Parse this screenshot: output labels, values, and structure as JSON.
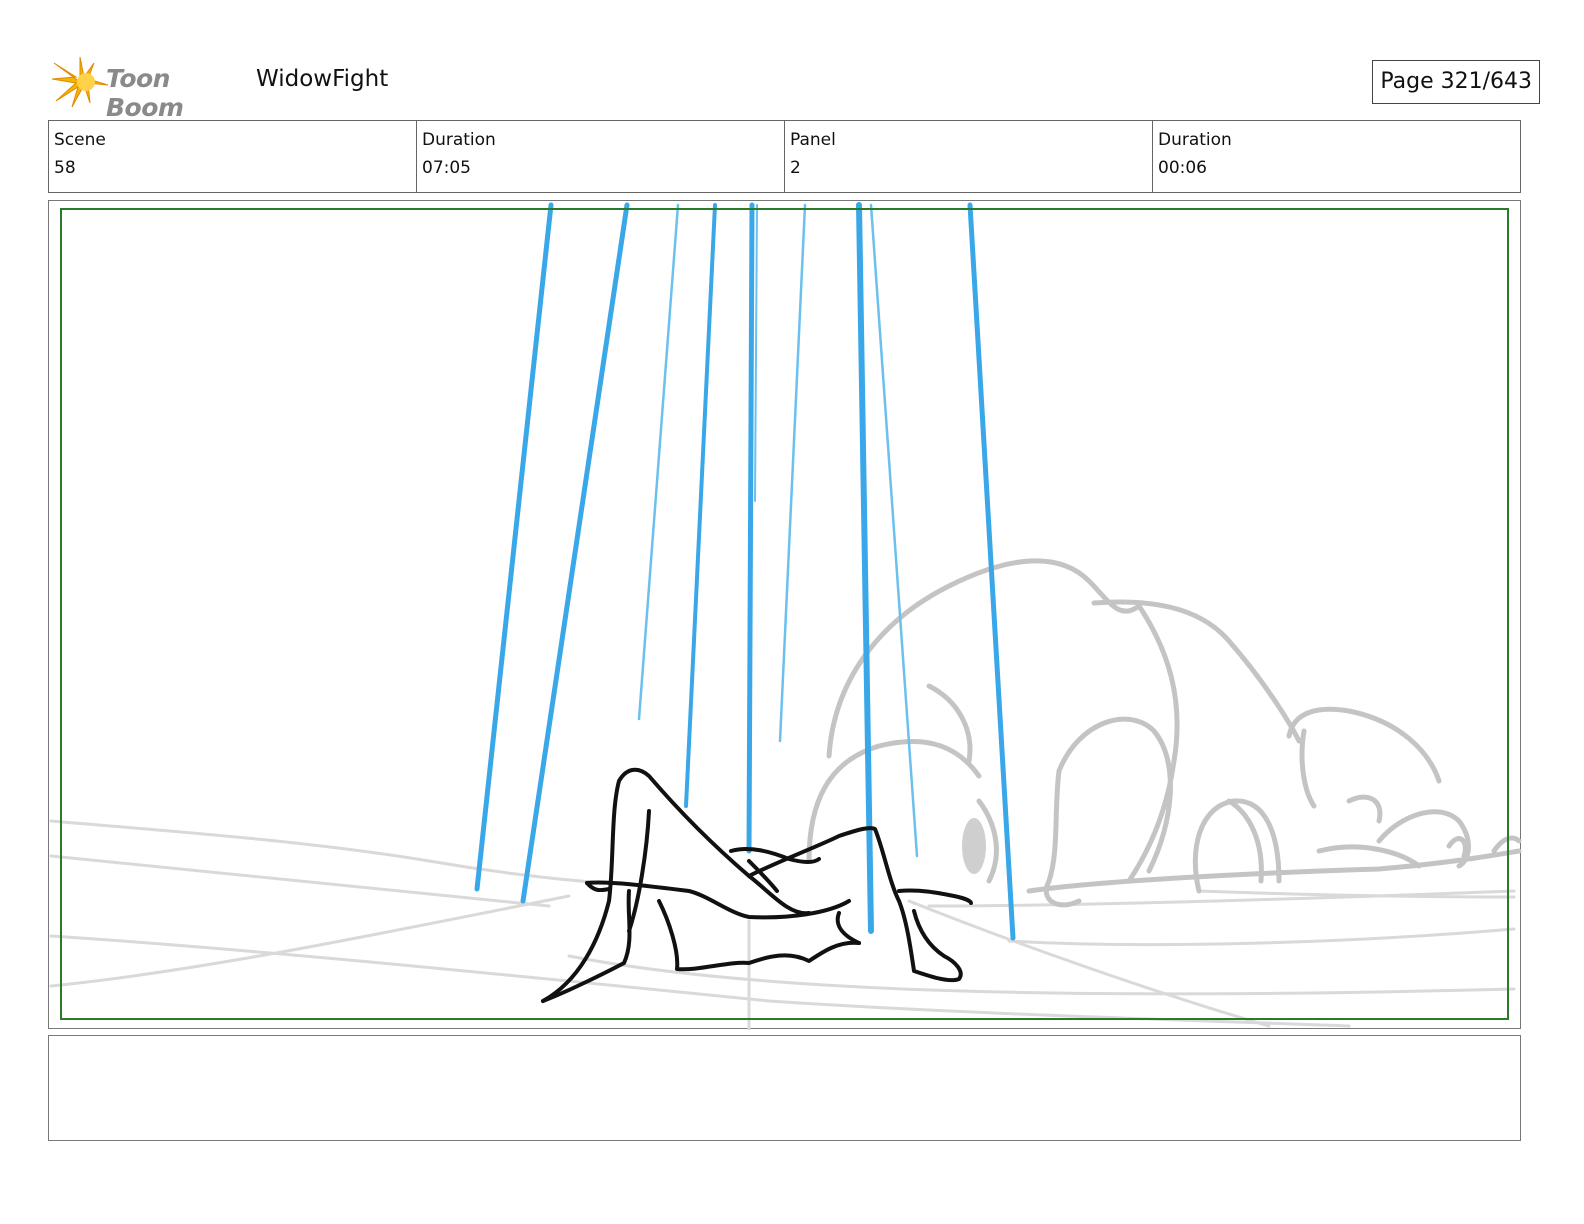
{
  "header": {
    "logo_text": "Toon Boom",
    "project_title": "WidowFight",
    "page_label": "Page 321/643"
  },
  "info": {
    "scene_label": "Scene",
    "scene_value": "58",
    "scene_duration_label": "Duration",
    "scene_duration_value": "07:05",
    "panel_label": "Panel",
    "panel_value": "2",
    "panel_duration_label": "Duration",
    "panel_duration_value": "00:06"
  },
  "colors": {
    "logo_star": "#f5b400",
    "safe_area": "#2a7a2a",
    "rain_lines": "#3aa8e8",
    "sketch_gray": "#c4c4c4",
    "character_ink": "#111111"
  },
  "notes": {
    "text": ""
  }
}
